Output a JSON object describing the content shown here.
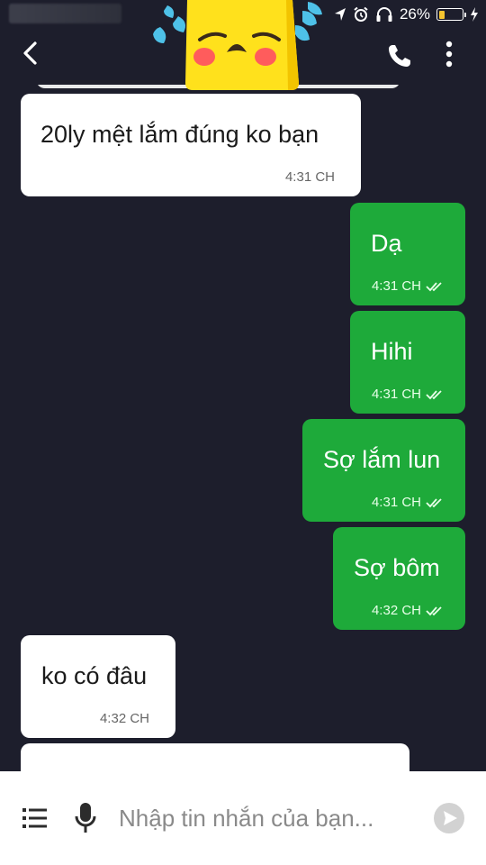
{
  "status_bar": {
    "battery_percent": "26%",
    "battery_level": 0.26,
    "icons": [
      "location-arrow-icon",
      "alarm-clock-icon",
      "headphones-icon",
      "battery-icon",
      "charging-bolt-icon"
    ]
  },
  "header": {
    "back_icon": "chevron-left-icon",
    "call_icon": "phone-icon",
    "more_icon": "vertical-dots-icon",
    "sticker": "crying-emoji-sticker"
  },
  "messages": [
    {
      "direction": "incoming",
      "text": "20ly mệt lắm đúng ko bạn",
      "time": "4:31 CH"
    },
    {
      "direction": "outgoing",
      "text": "Dạ",
      "time": "4:31 CH",
      "status_icon": "double-check-icon"
    },
    {
      "direction": "outgoing",
      "text": "Hihi",
      "time": "4:31 CH",
      "status_icon": "double-check-icon"
    },
    {
      "direction": "outgoing",
      "text": "Sợ lắm lun",
      "time": "4:31 CH",
      "status_icon": "double-check-icon"
    },
    {
      "direction": "outgoing",
      "text": "Sợ bôm",
      "time": "4:32 CH",
      "status_icon": "double-check-icon"
    },
    {
      "direction": "incoming",
      "text": "ko có đâu",
      "time": "4:32 CH"
    }
  ],
  "composer": {
    "placeholder": "Nhập tin nhắn của bạn...",
    "value": "",
    "menu_icon": "list-menu-icon",
    "mic_icon": "microphone-icon",
    "send_icon": "send-icon"
  },
  "colors": {
    "background": "#1d1e2c",
    "incoming_bubble": "#ffffff",
    "outgoing_bubble": "#1eaa3a",
    "battery_fill": "#f4c430"
  }
}
